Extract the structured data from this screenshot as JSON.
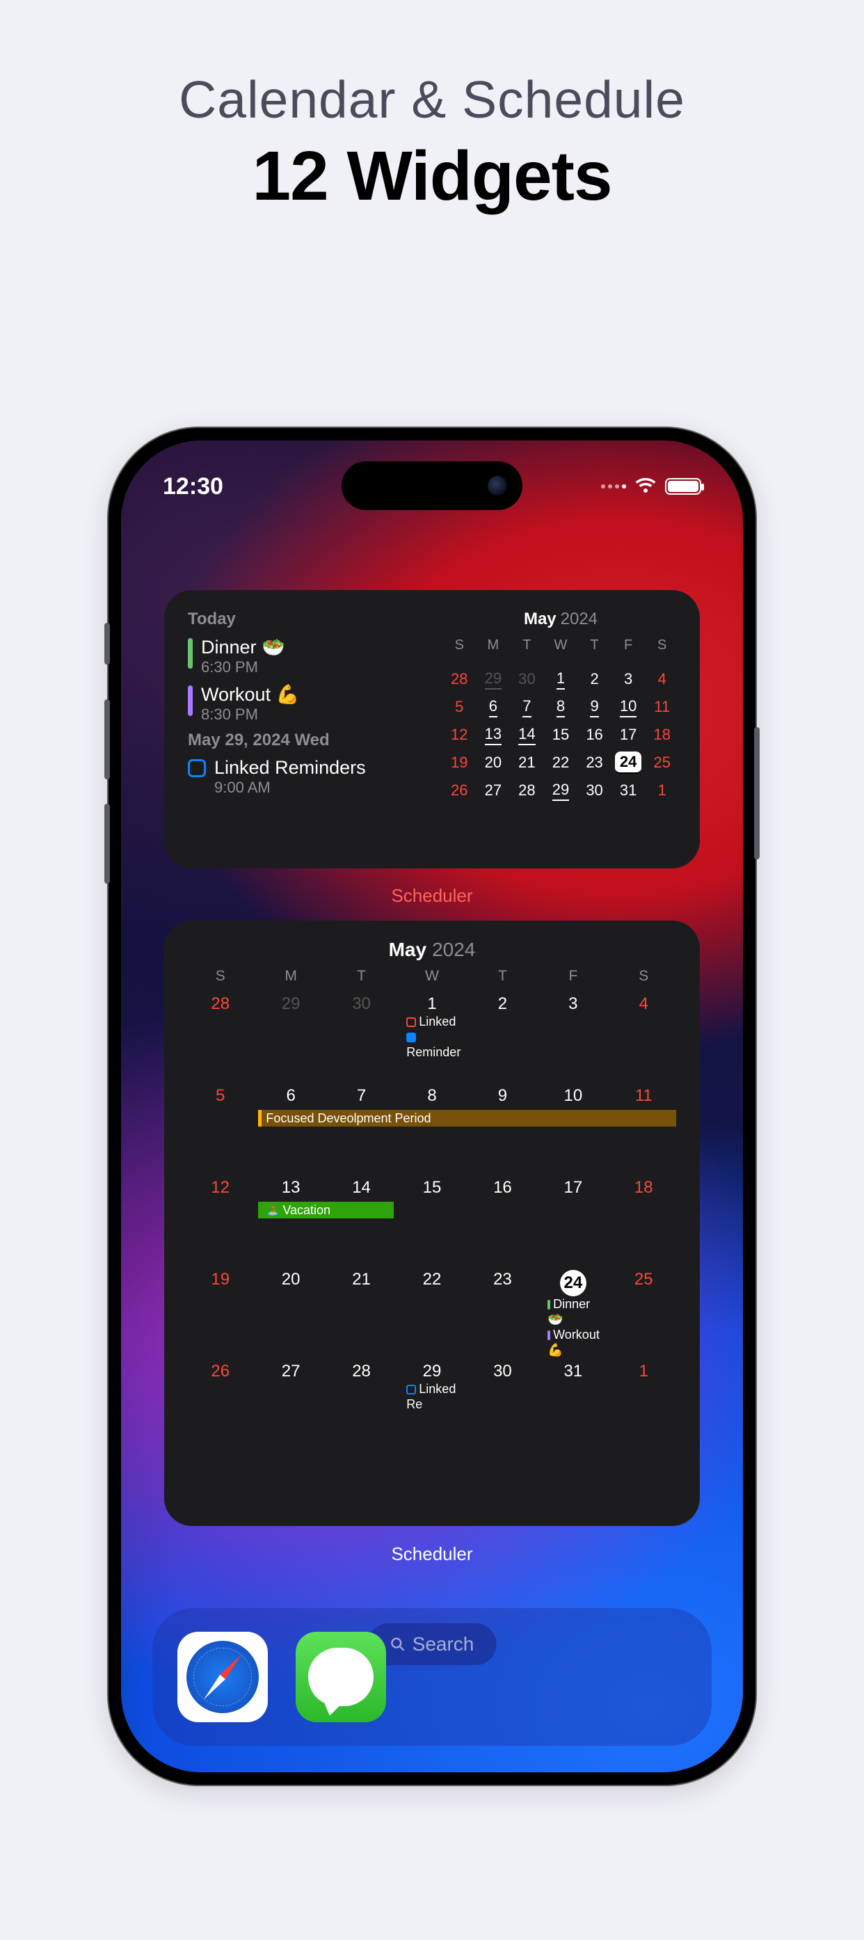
{
  "page": {
    "title": "Calendar & Schedule",
    "subtitle": "12 Widgets"
  },
  "status": {
    "time": "12:30"
  },
  "w1": {
    "today_label": "Today",
    "events": [
      {
        "title": "Dinner 🥗",
        "time": "6:30 PM",
        "color": "#6ac46a"
      },
      {
        "title": "Workout 💪",
        "time": "8:30 PM",
        "color": "#a97aff"
      }
    ],
    "date2_label": "May 29, 2024  Wed",
    "reminder": {
      "title": "Linked Reminders",
      "time": "9:00 AM"
    },
    "label": "Scheduler",
    "cal": {
      "month": "May",
      "year": "2024",
      "dow": [
        "S",
        "M",
        "T",
        "W",
        "T",
        "F",
        "S"
      ],
      "cells": [
        {
          "n": "28",
          "cls": "mut wk"
        },
        {
          "n": "29",
          "cls": "mut und"
        },
        {
          "n": "30",
          "cls": "mut"
        },
        {
          "n": "1",
          "cls": "und"
        },
        {
          "n": "2",
          "cls": ""
        },
        {
          "n": "3",
          "cls": ""
        },
        {
          "n": "4",
          "cls": "wk"
        },
        {
          "n": "5",
          "cls": "wk"
        },
        {
          "n": "6",
          "cls": "und"
        },
        {
          "n": "7",
          "cls": "und"
        },
        {
          "n": "8",
          "cls": "und"
        },
        {
          "n": "9",
          "cls": "und"
        },
        {
          "n": "10",
          "cls": "und"
        },
        {
          "n": "11",
          "cls": "wk"
        },
        {
          "n": "12",
          "cls": "wk"
        },
        {
          "n": "13",
          "cls": "und"
        },
        {
          "n": "14",
          "cls": "und"
        },
        {
          "n": "15",
          "cls": ""
        },
        {
          "n": "16",
          "cls": ""
        },
        {
          "n": "17",
          "cls": ""
        },
        {
          "n": "18",
          "cls": "wk"
        },
        {
          "n": "19",
          "cls": "wk"
        },
        {
          "n": "20",
          "cls": ""
        },
        {
          "n": "21",
          "cls": ""
        },
        {
          "n": "22",
          "cls": ""
        },
        {
          "n": "23",
          "cls": ""
        },
        {
          "n": "24",
          "cls": "today und"
        },
        {
          "n": "25",
          "cls": "wk"
        },
        {
          "n": "26",
          "cls": "wk"
        },
        {
          "n": "27",
          "cls": ""
        },
        {
          "n": "28",
          "cls": ""
        },
        {
          "n": "29",
          "cls": "und"
        },
        {
          "n": "30",
          "cls": ""
        },
        {
          "n": "31",
          "cls": ""
        },
        {
          "n": "1",
          "cls": "mut wk"
        }
      ]
    }
  },
  "w2": {
    "month": "May",
    "year": "2024",
    "dow": [
      "S",
      "M",
      "T",
      "W",
      "T",
      "F",
      "S"
    ],
    "weeks": [
      [
        {
          "n": "28",
          "cls": "mut wk"
        },
        {
          "n": "29",
          "cls": "mut"
        },
        {
          "n": "30",
          "cls": "mut"
        },
        {
          "n": "1",
          "inline": [
            {
              "t": "Linked",
              "box": "#ff453a"
            },
            {
              "t": "Reminder",
              "box": "#0a84ff",
              "checked": true
            }
          ]
        },
        {
          "n": "2"
        },
        {
          "n": "3"
        },
        {
          "n": "4",
          "cls": "wk"
        }
      ],
      [
        {
          "n": "5",
          "cls": "wk"
        },
        {
          "n": "6"
        },
        {
          "n": "7"
        },
        {
          "n": "8"
        },
        {
          "n": "9"
        },
        {
          "n": "10"
        },
        {
          "n": "11",
          "cls": "wk"
        }
      ],
      [
        {
          "n": "12",
          "cls": "wk"
        },
        {
          "n": "13"
        },
        {
          "n": "14"
        },
        {
          "n": "15"
        },
        {
          "n": "16"
        },
        {
          "n": "17"
        },
        {
          "n": "18",
          "cls": "wk"
        }
      ],
      [
        {
          "n": "19",
          "cls": "wk"
        },
        {
          "n": "20"
        },
        {
          "n": "21"
        },
        {
          "n": "22"
        },
        {
          "n": "23"
        },
        {
          "n": "24",
          "today": true,
          "inline": [
            {
              "t": "Dinner 🥗",
              "dot": "#6ac46a"
            },
            {
              "t": "Workout 💪",
              "dot": "#a97aff"
            }
          ]
        },
        {
          "n": "25",
          "cls": "wk"
        }
      ],
      [
        {
          "n": "26",
          "cls": "wk"
        },
        {
          "n": "27"
        },
        {
          "n": "28"
        },
        {
          "n": "29",
          "inline": [
            {
              "t": "Linked Re",
              "box": "#0a84ff"
            }
          ]
        },
        {
          "n": "30"
        },
        {
          "n": "31"
        },
        {
          "n": "1",
          "cls": "mut wk"
        }
      ]
    ],
    "chip_focused": "Focused Deveolpment Period",
    "chip_vacation": "Vacation",
    "label": "Scheduler"
  },
  "search": {
    "label": "Search"
  },
  "dock": {
    "apps": [
      "safari",
      "messages"
    ]
  }
}
